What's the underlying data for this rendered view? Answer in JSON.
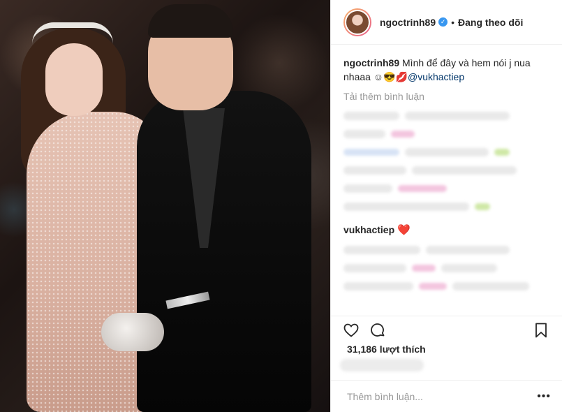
{
  "post": {
    "username": "ngoctrinh89",
    "verified_icon": "verified-badge-icon",
    "separator": "•",
    "follow_status": "Đang theo dõi"
  },
  "caption": {
    "username": "ngoctrinh89",
    "text": "Mình để đây và hem nói j nua nhaaa ☺😎💋",
    "mention": "@vukhactiep"
  },
  "comments": {
    "load_more": "Tải thêm bình luận",
    "reply_username": "vukhactiep",
    "reply_emoji": "❤️"
  },
  "actions": {
    "like_icon": "heart-outline-icon",
    "comment_icon": "comment-bubble-icon",
    "save_icon": "bookmark-icon"
  },
  "likes": {
    "text": "31,186 lượt thích"
  },
  "add_comment": {
    "placeholder": "Thêm bình luận...",
    "more": "•••"
  },
  "colors": {
    "link": "#003569",
    "verified": "#3897f0",
    "muted": "#999999",
    "heart": "#ed2b2b"
  }
}
